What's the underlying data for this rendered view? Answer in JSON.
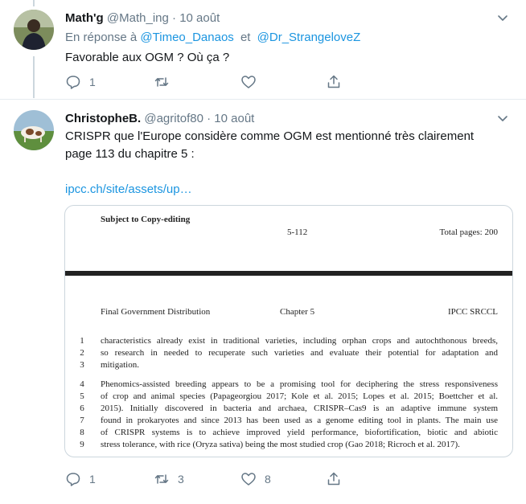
{
  "tweet1": {
    "name": "Math'g",
    "handle": "@Math_ing",
    "dot": "·",
    "date": "10 août",
    "reply_prefix": "En réponse à",
    "reply_user1": "@Timeo_Danaos",
    "reply_and": "et",
    "reply_user2": "@Dr_StrangeloveZ",
    "text": "Favorable aux OGM ? Où ça ?",
    "reply_count": "1",
    "retweet_count": "",
    "like_count": ""
  },
  "tweet2": {
    "name": "ChristopheB.",
    "handle": "@agritof80",
    "dot": "·",
    "date": "10 août",
    "text_line1": "CRISPR que l'Europe considère comme OGM est mentionné très clairement",
    "text_line2": "page 113 du chapitre 5 :",
    "link": "ipcc.ch/site/assets/up…",
    "reply_count": "1",
    "retweet_count": "3",
    "like_count": "8"
  },
  "document": {
    "subject": "Subject to Copy-editing",
    "page_ref": "5-112",
    "total_pages": "Total pages: 200",
    "distribution": "Final Government Distribution",
    "chapter": "Chapter 5",
    "report": "IPCC SRCCL",
    "lines": [
      {
        "num": "1",
        "text": "characteristics already exist in traditional varieties, including orphan crops and autochthonous breeds,"
      },
      {
        "num": "2",
        "text": "so research in needed to recuperate such varieties and evaluate their potential for adaptation and"
      },
      {
        "num": "3",
        "text": "mitigation."
      },
      {
        "num": "4",
        "text": "Phenomics-assisted breeding appears to be a promising tool for deciphering the stress responsiveness"
      },
      {
        "num": "5",
        "text": "of crop and animal species (Papageorgiou 2017; Kole et al. 2015; Lopes et al. 2015; Boettcher et al."
      },
      {
        "num": "6",
        "text": "2015). Initially discovered in bacteria and archaea, CRISPR–Cas9 is an adaptive immune system"
      },
      {
        "num": "7",
        "text": "found in prokaryotes and since 2013 has been used as a genome editing tool in plants. The main use"
      },
      {
        "num": "8",
        "text": "of CRISPR systems is to achieve improved yield performance, biofortification, biotic and abiotic"
      },
      {
        "num": "9",
        "text": "stress tolerance, with rice (Oryza sativa) being the most studied crop (Gao 2018; Ricroch et al. 2017)."
      }
    ]
  },
  "icons": [
    "caret-down-icon",
    "reply-icon",
    "retweet-icon",
    "like-icon",
    "share-icon"
  ],
  "colors": {
    "link": "#1b95e0",
    "muted": "#657786",
    "divider": "#e6ecf0"
  }
}
